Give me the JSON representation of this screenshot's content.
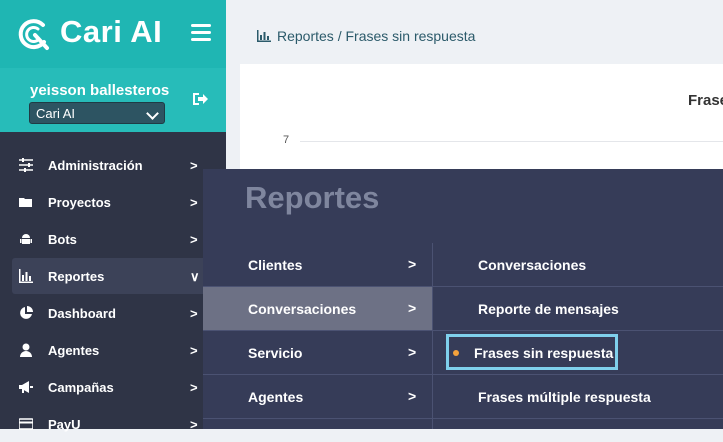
{
  "brand": {
    "name": "Cari AI",
    "color": "#1fb6b3",
    "icon": "cari-logo-icon"
  },
  "user": {
    "name": "yeisson ballesteros",
    "company": "Cari AI",
    "logout_icon": "logout-icon"
  },
  "sidebar": {
    "items": [
      {
        "label": "Administración",
        "icon": "sliders-icon",
        "arrow": ">"
      },
      {
        "label": "Proyectos",
        "icon": "folder-icon",
        "arrow": ">"
      },
      {
        "label": "Bots",
        "icon": "android-icon",
        "arrow": ">"
      },
      {
        "label": "Reportes",
        "icon": "bar-chart-icon",
        "arrow": "∨",
        "active": true
      },
      {
        "label": "Dashboard",
        "icon": "pie-chart-icon",
        "arrow": ">"
      },
      {
        "label": "Agentes",
        "icon": "user-icon",
        "arrow": ">"
      },
      {
        "label": "Campañas",
        "icon": "megaphone-icon",
        "arrow": ">"
      },
      {
        "label": "PayU",
        "icon": "card-icon",
        "arrow": ">"
      }
    ]
  },
  "breadcrumb": {
    "text": "Reportes / Frases sin respuesta",
    "icon": "bar-chart-icon"
  },
  "chart_card": {
    "title": "Frase",
    "tick_7": "7"
  },
  "mega_menu": {
    "title": "Reportes",
    "col1": [
      {
        "label": "Clientes",
        "arrow": ">"
      },
      {
        "label": "Conversaciones",
        "arrow": ">",
        "selected": true
      },
      {
        "label": "Servicio",
        "arrow": ">"
      },
      {
        "label": "Agentes",
        "arrow": ">"
      }
    ],
    "col2": [
      {
        "label": "Conversaciones"
      },
      {
        "label": "Reporte de mensajes"
      },
      {
        "label": "Frases sin respuesta",
        "current": true
      },
      {
        "label": "Frases múltiple respuesta"
      }
    ],
    "highlight_color": "#7fd0ec",
    "dot_color": "#f4a23c"
  }
}
